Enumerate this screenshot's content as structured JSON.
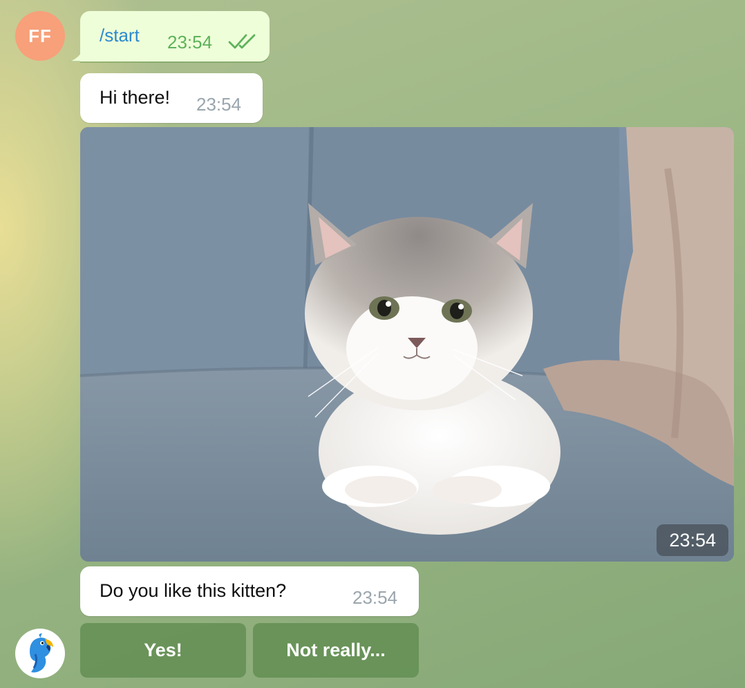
{
  "chat": {
    "user_avatar": {
      "initials": "FF",
      "color": "#f7a07a"
    },
    "bot_avatar": {
      "icon": "parrot-icon"
    },
    "messages": [
      {
        "type": "outgoing",
        "text": "/start",
        "time": "23:54",
        "status": "read"
      },
      {
        "type": "incoming",
        "text": "Hi there!",
        "time": "23:54"
      },
      {
        "type": "incoming-photo",
        "subject": "kitten-photo",
        "time": "23:54"
      },
      {
        "type": "incoming",
        "text": "Do you like this kitten?",
        "time": "23:54"
      }
    ],
    "keyboard": {
      "buttons": [
        {
          "label": "Yes!"
        },
        {
          "label": "Not really..."
        }
      ]
    }
  },
  "colors": {
    "outgoing_bubble": "#eefed9",
    "incoming_bubble": "#ffffff",
    "command_link": "#2b8ad0",
    "read_check": "#5db25a"
  }
}
